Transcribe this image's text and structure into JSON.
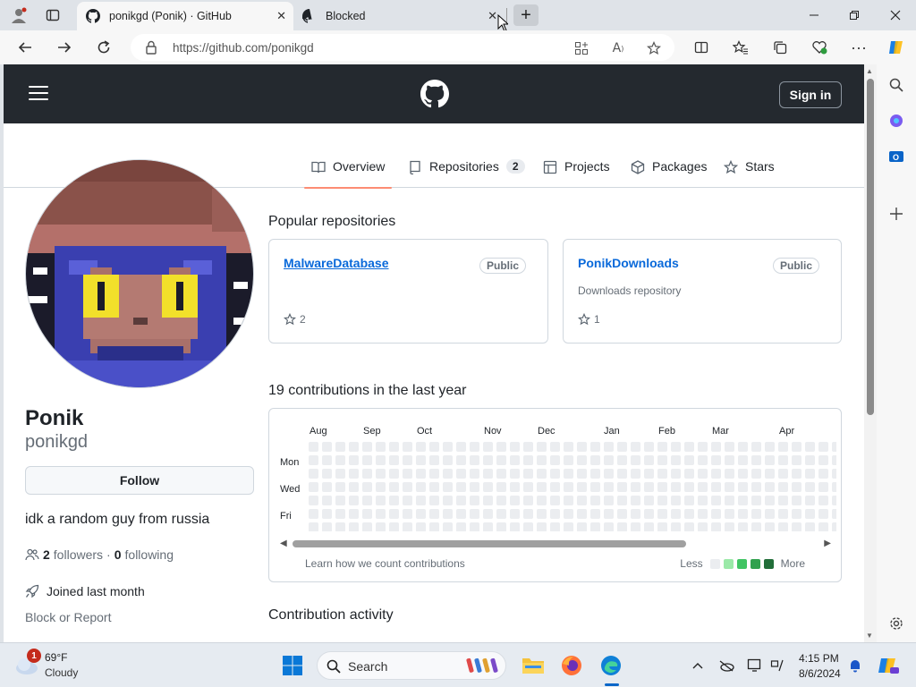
{
  "browser": {
    "tabs": [
      {
        "title": "ponikgd (Ponik) · GitHub",
        "active": true
      },
      {
        "title": "Blocked",
        "active": false
      }
    ],
    "url": "https://github.com/ponikgd"
  },
  "header": {
    "sign_in": "Sign in"
  },
  "profile_tabs": [
    {
      "label": "Overview",
      "icon": "book-icon",
      "selected": true
    },
    {
      "label": "Repositories",
      "icon": "repo-icon",
      "count": "2"
    },
    {
      "label": "Projects",
      "icon": "table-icon"
    },
    {
      "label": "Packages",
      "icon": "package-icon"
    },
    {
      "label": "Stars",
      "icon": "star-icon"
    }
  ],
  "profile": {
    "name": "Ponik",
    "login": "ponikgd",
    "follow_label": "Follow",
    "bio": "idk a random guy from russia",
    "followers_count": "2",
    "followers_label": "followers",
    "separator": "·",
    "following_count": "0",
    "following_label": "following",
    "joined": "Joined last month",
    "block_report": "Block or Report"
  },
  "popular": {
    "title": "Popular repositories",
    "repos": [
      {
        "name": "MalwareDatabase",
        "visibility": "Public",
        "description": "",
        "stars": "2"
      },
      {
        "name": "PonikDownloads",
        "visibility": "Public",
        "description": "Downloads repository",
        "stars": "1"
      }
    ]
  },
  "contributions": {
    "title": "19 contributions in the last year",
    "months": [
      "Aug",
      "Sep",
      "Oct",
      "Nov",
      "Dec",
      "Jan",
      "Feb",
      "Mar",
      "Apr"
    ],
    "days": [
      "Mon",
      "Wed",
      "Fri"
    ],
    "learn": "Learn how we count contributions",
    "less": "Less",
    "more": "More",
    "legend_colors": [
      "#ebedf0",
      "#9be9a8",
      "#40c463",
      "#30a14e",
      "#216e39"
    ]
  },
  "activity": {
    "title": "Contribution activity"
  },
  "taskbar": {
    "notification_count": "1",
    "weather_temp": "69°F",
    "weather_condition": "Cloudy",
    "search_label": "Search",
    "time": "4:15 PM",
    "date": "8/6/2024"
  }
}
